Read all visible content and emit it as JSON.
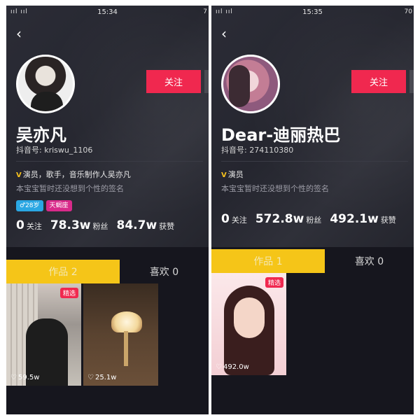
{
  "left": {
    "status_bar": {
      "signal": "ııl ııl",
      "time": "15:34",
      "battery": "7"
    },
    "name": "吴亦凡",
    "douyin_id": "抖音号: kriswu_1106",
    "follow_label": "关注",
    "verified_icon": "V",
    "verified_text": "演员，歌手，音乐制作人吴亦凡",
    "signature": "本宝宝暂时还没想到个性的签名",
    "tag_age": "♂28岁",
    "tag_zodiac": "天蝎座",
    "stats": [
      {
        "num": "0",
        "label": "关注"
      },
      {
        "num": "78.3w",
        "label": "粉丝"
      },
      {
        "num": "84.7w",
        "label": "获赞"
      }
    ],
    "tabs": {
      "works": "作品 2",
      "likes": "喜欢 0"
    },
    "videos": [
      {
        "badge": "精选",
        "likes": "59.5w"
      },
      {
        "badge": "",
        "likes": "25.1w"
      }
    ]
  },
  "right": {
    "status_bar": {
      "signal": "ııl ııl",
      "time": "15:35",
      "battery": "70"
    },
    "name": "Dear-迪丽热巴",
    "douyin_id": "抖音号: 274110380",
    "follow_label": "关注",
    "verified_icon": "V",
    "verified_text": "演员",
    "signature": "本宝宝暂时还没想到个性的签名",
    "stats": [
      {
        "num": "0",
        "label": "关注"
      },
      {
        "num": "572.8w",
        "label": "粉丝"
      },
      {
        "num": "492.1w",
        "label": "获赞"
      }
    ],
    "tabs": {
      "works": "作品 1",
      "likes": "喜欢 0"
    },
    "videos": [
      {
        "badge": "精选",
        "likes": "492.0w"
      }
    ]
  },
  "icons": {
    "back": "chevron-left-icon",
    "heart": "heart-outline-icon",
    "verified": "v-badge-icon"
  },
  "colors": {
    "follow": "#f0284f",
    "tab_active": "#f5c518",
    "tag_age": "#2aa7e3",
    "tag_zodiac": "#d82a8a",
    "background": "#16161e"
  }
}
